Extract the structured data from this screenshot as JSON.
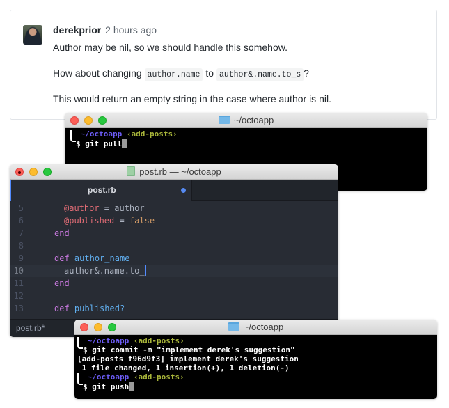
{
  "comment": {
    "author": "derekprior",
    "time": "2 hours ago",
    "p1": "Author may be nil, so we should handle this somehow.",
    "p2_before": "How about changing",
    "p2_code1": "author.name",
    "p2_mid": "to",
    "p2_code2": "author&.name.to_s",
    "p2_after": "?",
    "p3": "This would return an empty string in the case where author is nil."
  },
  "terminal_top": {
    "title": "~/octoapp",
    "prompt_path": "~/octoapp",
    "prompt_branch": "‹add-posts›",
    "command": "$ git pull"
  },
  "editor": {
    "title": "post.rb — ~/octoapp",
    "tab_label": "post.rb",
    "status_file": "post.rb*",
    "lines": [
      {
        "num": "5"
      },
      {
        "num": "6"
      },
      {
        "num": "7"
      },
      {
        "num": "8"
      },
      {
        "num": "9"
      },
      {
        "num": "10"
      },
      {
        "num": "11"
      },
      {
        "num": "12"
      },
      {
        "num": "13"
      }
    ],
    "code": {
      "l5_ivar": "@author",
      "l5_rest": " = author",
      "l6_ivar": "@published",
      "l6_eq": " = ",
      "l6_val": "false",
      "l7_kw": "end",
      "l9_kw": "def",
      "l9_fn": "author_name",
      "l10_text": "author&.name.to_",
      "l11_kw": "end",
      "l13_kw": "def",
      "l13_fn": "published?"
    }
  },
  "terminal_bottom": {
    "title": "~/octoapp",
    "prompt_path": "~/octoapp",
    "prompt_branch": "‹add-posts›",
    "command1": "$ git commit -m \"implement derek's suggestion\"",
    "output1": "[add-posts f96d9f3] implement derek's suggestion",
    "output2": " 1 file changed, 1 insertion(+), 1 deletion(-)",
    "command2": "$ git push"
  }
}
